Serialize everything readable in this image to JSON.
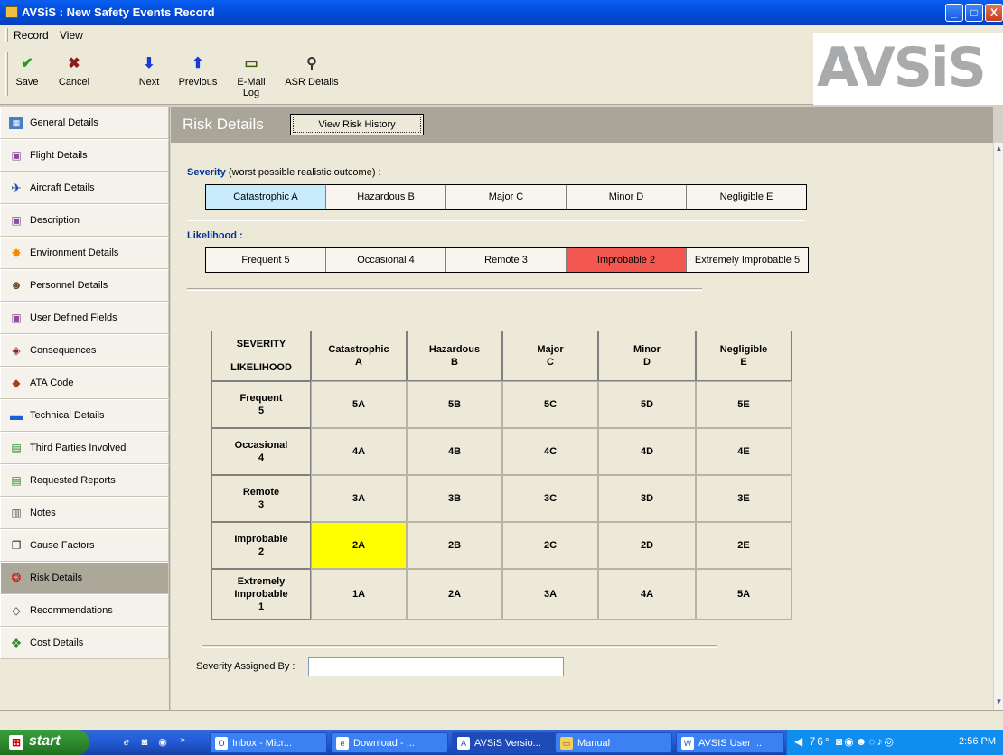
{
  "window": {
    "title": "AVSiS : New Safety Events Record",
    "controls": [
      "_",
      "□",
      "X"
    ]
  },
  "menu": {
    "items": [
      "Record",
      "View"
    ]
  },
  "toolbar": {
    "save": "Save",
    "cancel": "Cancel",
    "next": "Next",
    "previous": "Previous",
    "email_log": "E-Mail Log",
    "asr_details": "ASR Details"
  },
  "logo": {
    "text": "AVSiS"
  },
  "sidebar": {
    "items": [
      {
        "label": "General Details",
        "icon": "form-icon"
      },
      {
        "label": "Flight Details",
        "icon": "gallery-icon"
      },
      {
        "label": "Aircraft Details",
        "icon": "airplane-icon"
      },
      {
        "label": "Description",
        "icon": "gallery-icon"
      },
      {
        "label": "Environment Details",
        "icon": "sun-icon"
      },
      {
        "label": "Personnel Details",
        "icon": "person-icon"
      },
      {
        "label": "User Defined Fields",
        "icon": "gallery-icon"
      },
      {
        "label": "Consequences",
        "icon": "eraser-icon"
      },
      {
        "label": "ATA Code",
        "icon": "book-icon"
      },
      {
        "label": "Technical Details",
        "icon": "pipe-icon"
      },
      {
        "label": "Third Parties Involved",
        "icon": "folders-icon"
      },
      {
        "label": "Requested Reports",
        "icon": "folders-icon"
      },
      {
        "label": "Notes",
        "icon": "notes-icon"
      },
      {
        "label": "Cause Factors",
        "icon": "copy-icon"
      },
      {
        "label": "Risk Details",
        "icon": "risk-icon"
      },
      {
        "label": "Recommendations",
        "icon": "eraser-icon"
      },
      {
        "label": "Cost Details",
        "icon": "globe-icon"
      }
    ],
    "active_index": 14
  },
  "main": {
    "title": "Risk Details",
    "view_history_button": "View Risk History",
    "severity": {
      "label": "Severity",
      "sublabel": "(worst possible realistic outcome) :",
      "options": [
        "Catastrophic A",
        "Hazardous B",
        "Major C",
        "Minor D",
        "Negligible E"
      ],
      "selected": "Catastrophic A"
    },
    "likelihood": {
      "label": "Likelihood :",
      "options": [
        "Frequent 5",
        "Occasional 4",
        "Remote 3",
        "Improbable 2",
        "Extremely Improbable 5"
      ],
      "selected": "Improbable 2"
    },
    "matrix": {
      "corner_top": "SEVERITY",
      "corner_bottom": "LIKELIHOOD",
      "columns": [
        {
          "name": "Catastrophic",
          "code": "A"
        },
        {
          "name": "Hazardous",
          "code": "B"
        },
        {
          "name": "Major",
          "code": "C"
        },
        {
          "name": "Minor",
          "code": "D"
        },
        {
          "name": "Negligible",
          "code": "E"
        }
      ],
      "rows": [
        {
          "name": "Frequent",
          "code": "5",
          "cells": [
            "5A",
            "5B",
            "5C",
            "5D",
            "5E"
          ]
        },
        {
          "name": "Occasional",
          "code": "4",
          "cells": [
            "4A",
            "4B",
            "4C",
            "4D",
            "4E"
          ]
        },
        {
          "name": "Remote",
          "code": "3",
          "cells": [
            "3A",
            "3B",
            "3C",
            "3D",
            "3E"
          ]
        },
        {
          "name": "Improbable",
          "code": "2",
          "cells": [
            "2A",
            "2B",
            "2C",
            "2D",
            "2E"
          ]
        },
        {
          "name": "Extremely Improbable",
          "code": "1",
          "cells": [
            "1A",
            "2A",
            "3A",
            "4A",
            "5A"
          ]
        }
      ],
      "highlight_color": "#ffff00"
    },
    "assigned_by_label": "Severity Assigned By :",
    "assigned_by_value": ""
  },
  "taskbar": {
    "start": "start",
    "tasks": [
      {
        "label": "Inbox - Micr...",
        "icon": "outlook-icon"
      },
      {
        "label": "Download - ...",
        "icon": "ie-icon"
      },
      {
        "label": "AVSiS Versio...",
        "icon": "avsis-icon",
        "active": true
      },
      {
        "label": "Manual",
        "icon": "folder-icon"
      },
      {
        "label": "AVSIS User ...",
        "icon": "word-icon"
      }
    ],
    "temperature": "76°",
    "clock": "2:56 PM"
  },
  "colors": {
    "selected_severity": "#c9ecfc",
    "selected_likelihood": "#f2584f",
    "header_band": "#a9a598",
    "section_label": "#00339a"
  }
}
